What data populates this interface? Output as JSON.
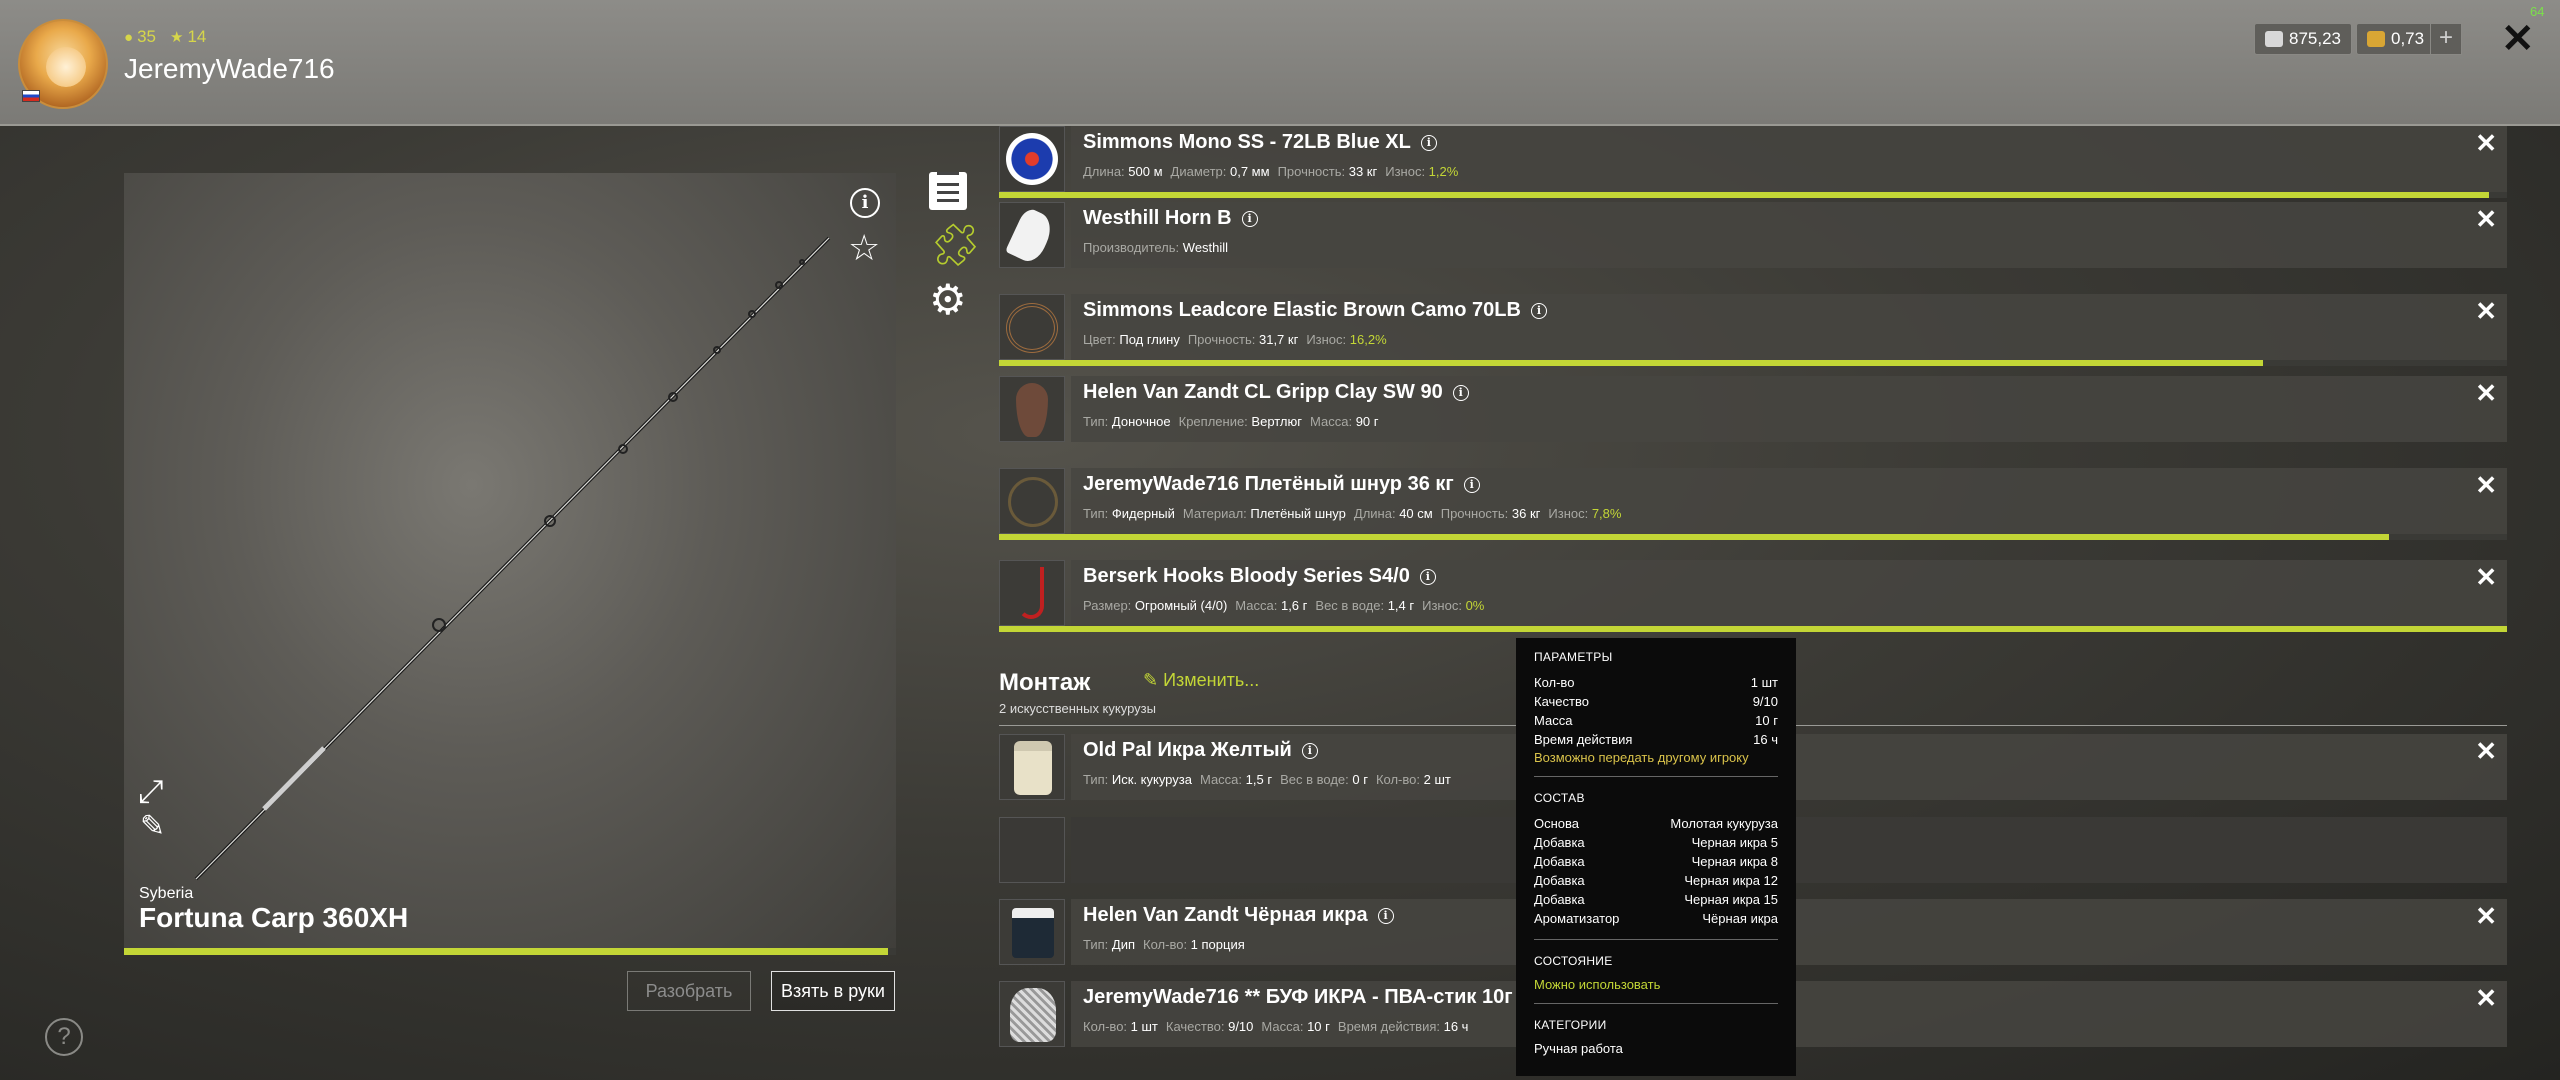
{
  "header": {
    "level": "35",
    "rating": "14",
    "username": "JeremyWade716",
    "silver": "875,23",
    "gold": "0,73",
    "fps": "64"
  },
  "rod": {
    "region": "Syberia",
    "name": "Fortuna Carp 360XH",
    "wear_fraction": 0.99,
    "btn_disassemble": "Разобрать",
    "btn_take": "Взять в руки"
  },
  "items": [
    {
      "name": "Simmons Mono SS - 72LB Blue XL",
      "props": [
        [
          "Длина:",
          "500 м"
        ],
        [
          "Диаметр:",
          "0,7 мм"
        ],
        [
          "Прочность:",
          "33 кг"
        ],
        [
          "Износ:",
          "1,2%"
        ]
      ],
      "wear_fraction": 0.988
    },
    {
      "name": "Westhill Horn B",
      "props": [
        [
          "Производитель:",
          "Westhill"
        ]
      ]
    },
    {
      "name": "Simmons Leadcore Elastic Brown Camo 70LB",
      "props": [
        [
          "Цвет:",
          "Под глину"
        ],
        [
          "Прочность:",
          "31,7 кг"
        ],
        [
          "Износ:",
          "16,2%"
        ]
      ],
      "wear_fraction": 0.838
    },
    {
      "name": "Helen Van Zandt CL Gripp Clay SW 90",
      "props": [
        [
          "Тип:",
          "Доночное"
        ],
        [
          "Крепление:",
          "Вертлюг"
        ],
        [
          "Масса:",
          "90 г"
        ]
      ]
    },
    {
      "name": "JeremyWade716 Плетёный шнур 36 кг",
      "props": [
        [
          "Тип:",
          "Фидерный"
        ],
        [
          "Материал:",
          "Плетёный шнур"
        ],
        [
          "Длина:",
          "40 см"
        ],
        [
          "Прочность:",
          "36 кг"
        ],
        [
          "Износ:",
          "7,8%"
        ]
      ],
      "wear_fraction": 0.922
    },
    {
      "name": "Berserk Hooks Bloody Series S4/0",
      "props": [
        [
          "Размер:",
          "Огромный (4/0)"
        ],
        [
          "Масса:",
          "1,6 г"
        ],
        [
          "Вес в воде:",
          "1,4 г"
        ],
        [
          "Износ:",
          "0%"
        ]
      ],
      "wear_fraction": 1.0
    }
  ],
  "montazh": {
    "title": "Монтаж",
    "edit_label": "Изменить...",
    "subtitle": "2 искусственных кукурузы"
  },
  "baits": [
    {
      "name": "Old Pal Икра Желтый",
      "props": [
        [
          "Тип:",
          "Иск. кукуруза"
        ],
        [
          "Масса:",
          "1,5 г"
        ],
        [
          "Вес в воде:",
          "0 г"
        ],
        [
          "Кол-во:",
          "2 шт"
        ]
      ]
    },
    {
      "name": "Helen Van Zandt Чёрная икра",
      "props": [
        [
          "Тип:",
          "Дип"
        ],
        [
          "Кол-во:",
          "1 порция"
        ]
      ]
    },
    {
      "name": "JeremyWade716 ** БУФ ИКРА - ПВА-стик 10г **",
      "props": [
        [
          "Кол-во:",
          "1 шт"
        ],
        [
          "Качество:",
          "9/10"
        ],
        [
          "Масса:",
          "10 г"
        ],
        [
          "Время действия:",
          "16 ч"
        ]
      ]
    }
  ],
  "tooltip": {
    "params_title": "ПАРАМЕТРЫ",
    "params": [
      [
        "Кол-во",
        "1 шт"
      ],
      [
        "Качество",
        "9/10"
      ],
      [
        "Масса",
        "10 г"
      ],
      [
        "Время действия",
        "16 ч"
      ]
    ],
    "transfer_note": "Возможно передать другому игроку",
    "composition_title": "СОСТАВ",
    "composition": [
      [
        "Основа",
        "Молотая кукуруза"
      ],
      [
        "Добавка",
        "Черная икра 5"
      ],
      [
        "Добавка",
        "Черная икра 8"
      ],
      [
        "Добавка",
        "Черная икра 12"
      ],
      [
        "Добавка",
        "Черная икра 15"
      ],
      [
        "Ароматизатор",
        "Чёрная икра"
      ]
    ],
    "state_title": "СОСТОЯНИЕ",
    "state_value": "Можно использовать",
    "categories_title": "КАТЕГОРИИ",
    "categories_value": "Ручная работа"
  },
  "colors": {
    "accent": "#c3d636",
    "warning": "#d9c24a"
  }
}
